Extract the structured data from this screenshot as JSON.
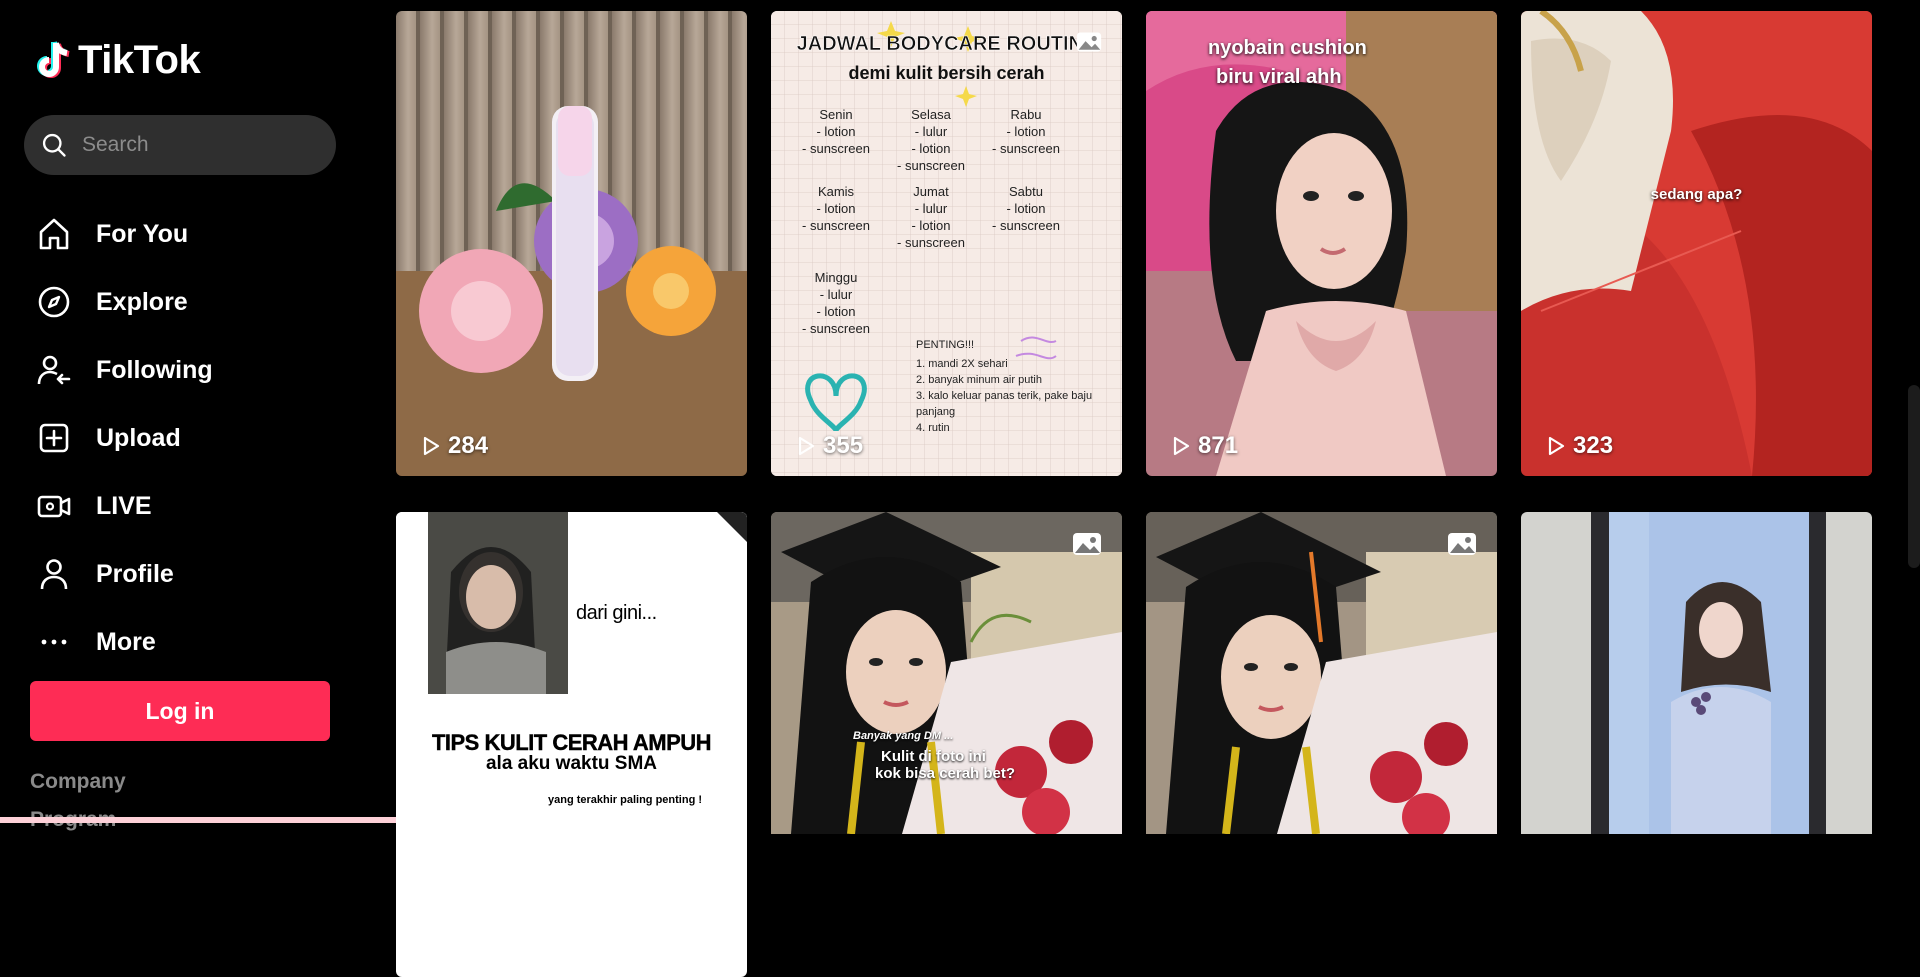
{
  "app": {
    "name": "TikTok"
  },
  "search": {
    "placeholder": "Search"
  },
  "nav": [
    {
      "label": "For You",
      "icon": "home-icon"
    },
    {
      "label": "Explore",
      "icon": "compass-icon"
    },
    {
      "label": "Following",
      "icon": "following-icon"
    },
    {
      "label": "Upload",
      "icon": "upload-icon"
    },
    {
      "label": "LIVE",
      "icon": "live-icon"
    },
    {
      "label": "Profile",
      "icon": "profile-icon"
    },
    {
      "label": "More",
      "icon": "more-icon"
    }
  ],
  "login": {
    "label": "Log in"
  },
  "footer": {
    "company": "Company",
    "program": "Program"
  },
  "colors": {
    "accent": "#fe2c55",
    "background": "#000000",
    "search_bg": "#2f2f2f"
  },
  "videos": [
    {
      "views": "284"
    },
    {
      "views": "355",
      "title": "JADWAL BODYCARE ROUTINE",
      "subtitle": "demi kulit bersih cerah",
      "days": [
        {
          "day": "Senin",
          "items": [
            "- lotion",
            "- sunscreen"
          ]
        },
        {
          "day": "Selasa",
          "items": [
            "- lulur",
            "- lotion",
            "- sunscreen"
          ]
        },
        {
          "day": "Rabu",
          "items": [
            "- lotion",
            "- sunscreen"
          ]
        },
        {
          "day": "Kamis",
          "items": [
            "- lotion",
            "- sunscreen"
          ]
        },
        {
          "day": "Jumat",
          "items": [
            "- lulur",
            "- lotion",
            "- sunscreen"
          ]
        },
        {
          "day": "Sabtu",
          "items": [
            "- lotion",
            "- sunscreen"
          ]
        },
        {
          "day": "Minggu",
          "items": [
            "- lulur",
            "- lotion",
            "- sunscreen"
          ]
        }
      ],
      "note_title": "PENTING!!!",
      "notes": [
        "1. mandi 2X sehari",
        "2. banyak minum air putih",
        "3. kalo keluar panas terik, pake baju panjang",
        "4. rutin"
      ]
    },
    {
      "views": "871",
      "caption_line1": "nyobain cushion",
      "caption_line2": "biru viral ahh"
    },
    {
      "views": "323",
      "caption": "sedang apa?"
    },
    {
      "caption": "dari gini...",
      "headline": "TIPS KULIT CERAH AMPUH",
      "subheadline": "ala aku waktu SMA",
      "footnote": "yang terakhir paling penting !"
    },
    {
      "caption_small": "Banyak yang DM ...",
      "caption_line1": "Kulit di foto ini",
      "caption_line2": "kok bisa cerah bet?"
    },
    {},
    {}
  ]
}
